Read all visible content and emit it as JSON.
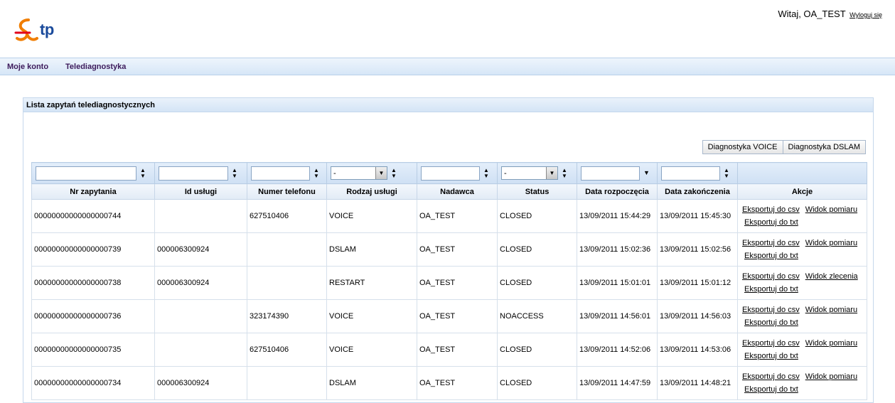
{
  "header": {
    "logo_text": "tp",
    "greeting": "Witaj, OA_TEST",
    "logout": "Wyloguj się"
  },
  "nav": {
    "items": [
      "Moje konto",
      "Telediagnostyka"
    ]
  },
  "panel": {
    "title": "Lista zapytań telediagnostycznych",
    "buttons": [
      "Diagnostyka VOICE",
      "Diagnostyka DSLAM"
    ],
    "filters": {
      "rodzaj_value": "-",
      "status_value": "-"
    },
    "columns": [
      "Nr zapytania",
      "Id usługi",
      "Numer telefonu",
      "Rodzaj usługi",
      "Nadawca",
      "Status",
      "Data rozpoczęcia",
      "Data zakończenia",
      "Akcje"
    ],
    "rows": [
      {
        "nr": "00000000000000000744",
        "id": "",
        "tel": "627510406",
        "rodzaj": "VOICE",
        "nadawca": "OA_TEST",
        "status": "CLOSED",
        "start": "13/09/2011 15:44:29",
        "end": "13/09/2011 15:45:30",
        "a1": "Eksportuj do csv",
        "a2": "Widok pomiaru",
        "a3": "Eksportuj do txt"
      },
      {
        "nr": "00000000000000000739",
        "id": "000006300924",
        "tel": "",
        "rodzaj": "DSLAM",
        "nadawca": "OA_TEST",
        "status": "CLOSED",
        "start": "13/09/2011 15:02:36",
        "end": "13/09/2011 15:02:56",
        "a1": "Eksportuj do csv",
        "a2": "Widok pomiaru",
        "a3": "Eksportuj do txt"
      },
      {
        "nr": "00000000000000000738",
        "id": "000006300924",
        "tel": "",
        "rodzaj": "RESTART",
        "nadawca": "OA_TEST",
        "status": "CLOSED",
        "start": "13/09/2011 15:01:01",
        "end": "13/09/2011 15:01:12",
        "a1": "Eksportuj do csv",
        "a2": "Widok zlecenia",
        "a3": "Eksportuj do txt"
      },
      {
        "nr": "00000000000000000736",
        "id": "",
        "tel": "323174390",
        "rodzaj": "VOICE",
        "nadawca": "OA_TEST",
        "status": "NOACCESS",
        "start": "13/09/2011 14:56:01",
        "end": "13/09/2011 14:56:03",
        "a1": "Eksportuj do csv",
        "a2": "Widok pomiaru",
        "a3": "Eksportuj do txt"
      },
      {
        "nr": "00000000000000000735",
        "id": "",
        "tel": "627510406",
        "rodzaj": "VOICE",
        "nadawca": "OA_TEST",
        "status": "CLOSED",
        "start": "13/09/2011 14:52:06",
        "end": "13/09/2011 14:53:06",
        "a1": "Eksportuj do csv",
        "a2": "Widok pomiaru",
        "a3": "Eksportuj do txt"
      },
      {
        "nr": "00000000000000000734",
        "id": "000006300924",
        "tel": "",
        "rodzaj": "DSLAM",
        "nadawca": "OA_TEST",
        "status": "CLOSED",
        "start": "13/09/2011 14:47:59",
        "end": "13/09/2011 14:48:21",
        "a1": "Eksportuj do csv",
        "a2": "Widok pomiaru",
        "a3": "Eksportuj do txt"
      }
    ]
  },
  "colors": {
    "brand_orange": "#f07d00",
    "brand_blue": "#1a4a9b",
    "nav_text": "#3c1a5b"
  },
  "icons": {
    "logo": "tp-logo-ribbon",
    "sort": "sort-updown-icon",
    "dropdown": "chevron-down-icon"
  }
}
